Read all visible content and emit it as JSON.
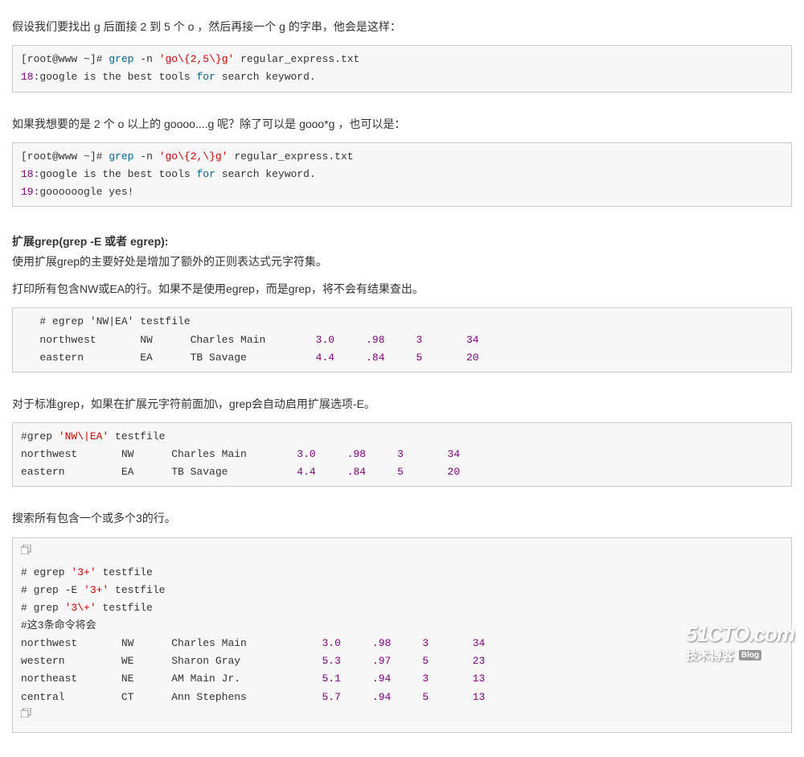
{
  "para1": "假设我们要找出 g 后面接 2 到 5 个 o ，然后再接一个 g 的字串，他会是这样：",
  "code1": {
    "prompt1": "[root@www ~]#",
    "cmd1": "grep",
    "opt1": "-n",
    "str1": "'go\\{2,5\\}g'",
    "file1": "regular_express.txt",
    "ln1": "18",
    "out1a": ":google is the best tools",
    "kw1": "for",
    "out1b": "search keyword."
  },
  "para2": "如果我想要的是 2 个 o 以上的 goooo....g 呢？除了可以是 gooo*g ，也可以是：",
  "code2": {
    "prompt1": "[root@www ~]#",
    "cmd1": "grep",
    "opt1": "-n",
    "str1": "'go\\{2,\\}g'",
    "file1": "regular_express.txt",
    "ln1": "18",
    "out1a": ":google is the best tools",
    "kw1": "for",
    "out1b": "search keyword.",
    "ln2": "19",
    "out2": ":goooooogle yes!"
  },
  "heading": "扩展grep(grep -E 或者 egrep):",
  "para3": "使用扩展grep的主要好处是增加了额外的正则表达式元字符集。",
  "para4": "打印所有包含NW或EA的行。如果不是使用egrep，而是grep，将不会有结果查出。",
  "code3": {
    "l1": "   # egrep 'NW|EA' testfile",
    "l2": "   northwest       NW      Charles Main        ",
    "l2n": [
      "3.0",
      ".98",
      "3",
      "34"
    ],
    "l3": "   eastern         EA      TB Savage           ",
    "l3n": [
      "4.4",
      ".84",
      "5",
      "20"
    ]
  },
  "para5": "对于标准grep，如果在扩展元字符前面加\\，grep会自动启用扩展选项-E。",
  "code4": {
    "l1a": "#grep ",
    "l1s": "'NW\\|EA'",
    "l1b": " testfile",
    "l2": "northwest       NW      Charles Main        ",
    "l2n": [
      "3.0",
      ".98",
      "3",
      "34"
    ],
    "l3": "eastern         EA      TB Savage           ",
    "l3n": [
      "4.4",
      ".84",
      "5",
      "20"
    ]
  },
  "para6": "搜索所有包含一个或多个3的行。",
  "code5": {
    "c1": {
      "a": "# egrep ",
      "s": "'3+'",
      "b": " testfile"
    },
    "c2": {
      "a": "# grep -E ",
      "s": "'3+'",
      "b": " testfile"
    },
    "c3": {
      "a": "# grep ",
      "s": "'3\\+'",
      "b": " testfile"
    },
    "note": "#这3条命令将会",
    "rows": [
      {
        "p": "northwest       NW      Charles Main            ",
        "n": [
          "3.0",
          ".98",
          "3",
          "34"
        ]
      },
      {
        "p": "western         WE      Sharon Gray             ",
        "n": [
          "5.3",
          ".97",
          "5",
          "23"
        ]
      },
      {
        "p": "northeast       NE      AM Main Jr.             ",
        "n": [
          "5.1",
          ".94",
          "3",
          "13"
        ]
      },
      {
        "p": "central         CT      Ann Stephens            ",
        "n": [
          "5.7",
          ".94",
          "5",
          "13"
        ]
      }
    ]
  },
  "watermark": {
    "big": "51CTO.com",
    "sub": "技术博客",
    "badge": "Blog"
  }
}
